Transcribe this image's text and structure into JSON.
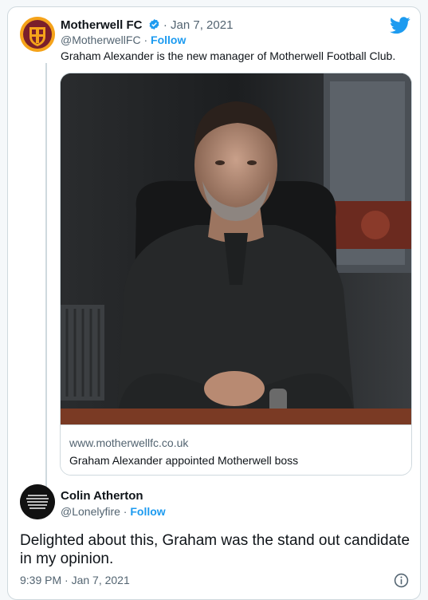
{
  "tweet": {
    "author_name": "Motherwell FC",
    "separator": " · ",
    "date": "Jan 7, 2021",
    "handle": "@MotherwellFC",
    "follow_label": "Follow",
    "text": "Graham Alexander is the new manager of Motherwell Football Club.",
    "avatar_icon": "motherwell-crest",
    "link_card": {
      "domain": "www.motherwellfc.co.uk",
      "title": "Graham Alexander appointed Motherwell boss"
    }
  },
  "reply": {
    "author_name": "Colin Atherton",
    "handle": "@Lonelyfire",
    "separator": " · ",
    "follow_label": "Follow",
    "text": "Delighted about this, Graham was the stand out candidate in my opinion.",
    "timestamp": "9:39 PM · Jan 7, 2021",
    "avatar_icon": "dark-text-avatar"
  },
  "colors": {
    "accent": "#1d9bf0",
    "muted": "#536471",
    "border": "#cfd9de",
    "text": "#0f1419"
  }
}
